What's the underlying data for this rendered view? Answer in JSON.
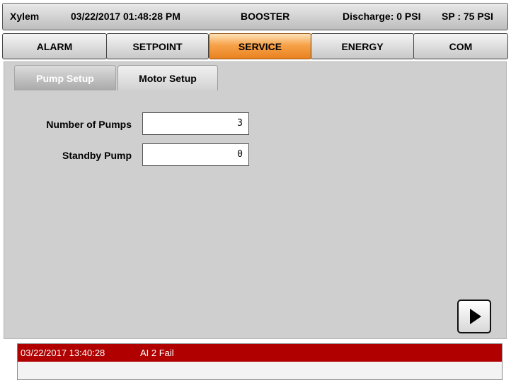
{
  "header": {
    "brand": "Xylem",
    "datetime": "03/22/2017 01:48:28 PM",
    "mode": "BOOSTER",
    "discharge": "Discharge: 0 PSI",
    "setpoint": "SP : 75 PSI"
  },
  "nav": {
    "tabs": [
      {
        "label": "ALARM",
        "active": false
      },
      {
        "label": "SETPOINT",
        "active": false
      },
      {
        "label": "SERVICE",
        "active": true
      },
      {
        "label": "ENERGY",
        "active": false
      },
      {
        "label": "COM",
        "active": false
      }
    ]
  },
  "subtabs": [
    {
      "label": "Pump Setup",
      "active": true
    },
    {
      "label": "Motor Setup",
      "active": false
    }
  ],
  "form": {
    "num_pumps_label": "Number of Pumps",
    "num_pumps_value": "3",
    "standby_label": "Standby Pump",
    "standby_value": "0"
  },
  "next_button": {
    "icon": "play-arrow-icon"
  },
  "alarm": {
    "timestamp": "03/22/2017 13:40:28",
    "message": "AI 2 Fail",
    "color": "#b00000"
  },
  "colors": {
    "active_tab": "#f7a24a",
    "panel": "#cfcfcf"
  }
}
